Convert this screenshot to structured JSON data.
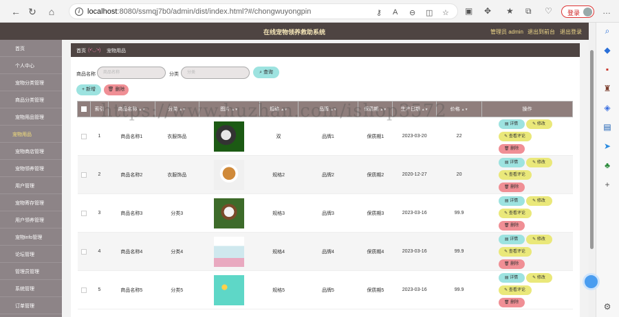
{
  "browser": {
    "url_host": "localhost",
    "url_path": ":8080/ssmqj7b0/admin/dist/index.html?#/chongwuyongpin",
    "login_label": "登录"
  },
  "app": {
    "title": "在线宠物领养救助系统",
    "admin_label": "管理员 admin",
    "front_link": "退出到前台",
    "logout_link": "退出登录"
  },
  "sidebar": {
    "items": [
      {
        "label": "首页"
      },
      {
        "label": "个人中心"
      },
      {
        "label": "宠物分类管理"
      },
      {
        "label": "商品分类管理"
      },
      {
        "label": "宠物用品管理"
      },
      {
        "label": "宠物用品"
      },
      {
        "label": "宠物商店管理"
      },
      {
        "label": "宠物领养管理"
      },
      {
        "label": "用户管理"
      },
      {
        "label": "宠物寄存管理"
      },
      {
        "label": "用户领养管理"
      },
      {
        "label": "宠物info管理"
      },
      {
        "label": "论坛管理"
      },
      {
        "label": "管理员管理"
      },
      {
        "label": "系统管理"
      },
      {
        "label": "订单管理"
      }
    ]
  },
  "breadcrumb": {
    "home": "首页",
    "emote": "(•'◡'•)",
    "current": "宠物用品"
  },
  "filter": {
    "name_label": "商品名称",
    "name_placeholder": "商品名称",
    "category_label": "分类",
    "category_placeholder": "分类",
    "query_button": "查询"
  },
  "actions": {
    "add": "新增",
    "delete": "删除"
  },
  "watermark": "https://www.huzhan.com/ishop3572",
  "table": {
    "headers": [
      "索引",
      "商品名称",
      "分类",
      "图片",
      "规格",
      "品牌",
      "保质期",
      "生产日期",
      "价格",
      "操作"
    ],
    "op_labels": {
      "detail": "详情",
      "edit": "修改",
      "comment": "查看评论",
      "remove": "删除"
    },
    "rows": [
      {
        "index": "1",
        "name": "商品名称1",
        "category": "衣服饰品",
        "spec": "双",
        "brand": "品牌1",
        "shelf": "保质期1",
        "date": "2023-03-20",
        "price": "22",
        "image": "dog-toy-photo"
      },
      {
        "index": "2",
        "name": "商品名称2",
        "category": "衣服饰品",
        "spec": "规格2",
        "brand": "品牌2",
        "shelf": "保质期2",
        "date": "2020-12-27",
        "price": "20",
        "image": "dog-photo"
      },
      {
        "index": "3",
        "name": "商品名称3",
        "category": "分类3",
        "spec": "规格3",
        "brand": "品牌3",
        "shelf": "保质期3",
        "date": "2023-03-16",
        "price": "99.9",
        "image": "running-dog-photo"
      },
      {
        "index": "4",
        "name": "商品名称4",
        "category": "分类4",
        "spec": "规格4",
        "brand": "品牌4",
        "shelf": "保质期4",
        "date": "2023-03-16",
        "price": "99.9",
        "image": "pet-feeder-photo"
      },
      {
        "index": "5",
        "name": "商品名称5",
        "category": "分类5",
        "spec": "规格5",
        "brand": "品牌5",
        "shelf": "保质期5",
        "date": "2023-03-16",
        "price": "99.9",
        "image": "pet-bowls-photo"
      }
    ]
  }
}
